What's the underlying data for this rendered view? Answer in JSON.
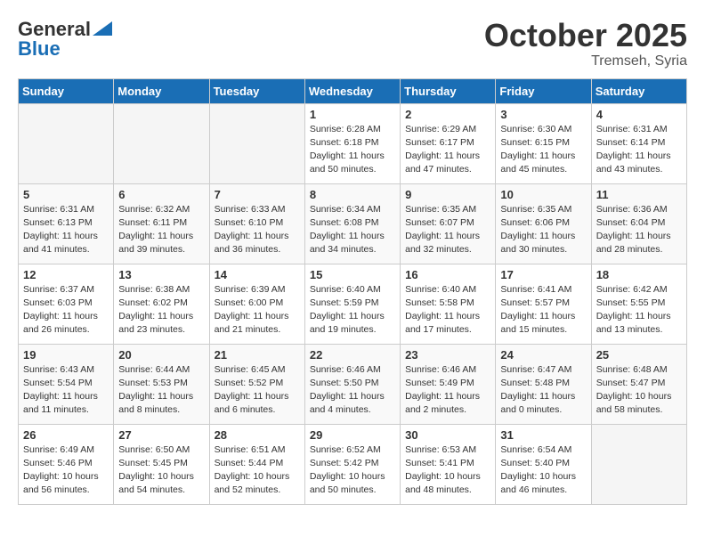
{
  "header": {
    "logo_general": "General",
    "logo_blue": "Blue",
    "month_title": "October 2025",
    "location": "Tremseh, Syria"
  },
  "weekdays": [
    "Sunday",
    "Monday",
    "Tuesday",
    "Wednesday",
    "Thursday",
    "Friday",
    "Saturday"
  ],
  "weeks": [
    [
      {
        "day": "",
        "empty": true
      },
      {
        "day": "",
        "empty": true
      },
      {
        "day": "",
        "empty": true
      },
      {
        "day": "1",
        "sunrise": "Sunrise: 6:28 AM",
        "sunset": "Sunset: 6:18 PM",
        "daylight": "Daylight: 11 hours and 50 minutes."
      },
      {
        "day": "2",
        "sunrise": "Sunrise: 6:29 AM",
        "sunset": "Sunset: 6:17 PM",
        "daylight": "Daylight: 11 hours and 47 minutes."
      },
      {
        "day": "3",
        "sunrise": "Sunrise: 6:30 AM",
        "sunset": "Sunset: 6:15 PM",
        "daylight": "Daylight: 11 hours and 45 minutes."
      },
      {
        "day": "4",
        "sunrise": "Sunrise: 6:31 AM",
        "sunset": "Sunset: 6:14 PM",
        "daylight": "Daylight: 11 hours and 43 minutes."
      }
    ],
    [
      {
        "day": "5",
        "sunrise": "Sunrise: 6:31 AM",
        "sunset": "Sunset: 6:13 PM",
        "daylight": "Daylight: 11 hours and 41 minutes."
      },
      {
        "day": "6",
        "sunrise": "Sunrise: 6:32 AM",
        "sunset": "Sunset: 6:11 PM",
        "daylight": "Daylight: 11 hours and 39 minutes."
      },
      {
        "day": "7",
        "sunrise": "Sunrise: 6:33 AM",
        "sunset": "Sunset: 6:10 PM",
        "daylight": "Daylight: 11 hours and 36 minutes."
      },
      {
        "day": "8",
        "sunrise": "Sunrise: 6:34 AM",
        "sunset": "Sunset: 6:08 PM",
        "daylight": "Daylight: 11 hours and 34 minutes."
      },
      {
        "day": "9",
        "sunrise": "Sunrise: 6:35 AM",
        "sunset": "Sunset: 6:07 PM",
        "daylight": "Daylight: 11 hours and 32 minutes."
      },
      {
        "day": "10",
        "sunrise": "Sunrise: 6:35 AM",
        "sunset": "Sunset: 6:06 PM",
        "daylight": "Daylight: 11 hours and 30 minutes."
      },
      {
        "day": "11",
        "sunrise": "Sunrise: 6:36 AM",
        "sunset": "Sunset: 6:04 PM",
        "daylight": "Daylight: 11 hours and 28 minutes."
      }
    ],
    [
      {
        "day": "12",
        "sunrise": "Sunrise: 6:37 AM",
        "sunset": "Sunset: 6:03 PM",
        "daylight": "Daylight: 11 hours and 26 minutes."
      },
      {
        "day": "13",
        "sunrise": "Sunrise: 6:38 AM",
        "sunset": "Sunset: 6:02 PM",
        "daylight": "Daylight: 11 hours and 23 minutes."
      },
      {
        "day": "14",
        "sunrise": "Sunrise: 6:39 AM",
        "sunset": "Sunset: 6:00 PM",
        "daylight": "Daylight: 11 hours and 21 minutes."
      },
      {
        "day": "15",
        "sunrise": "Sunrise: 6:40 AM",
        "sunset": "Sunset: 5:59 PM",
        "daylight": "Daylight: 11 hours and 19 minutes."
      },
      {
        "day": "16",
        "sunrise": "Sunrise: 6:40 AM",
        "sunset": "Sunset: 5:58 PM",
        "daylight": "Daylight: 11 hours and 17 minutes."
      },
      {
        "day": "17",
        "sunrise": "Sunrise: 6:41 AM",
        "sunset": "Sunset: 5:57 PM",
        "daylight": "Daylight: 11 hours and 15 minutes."
      },
      {
        "day": "18",
        "sunrise": "Sunrise: 6:42 AM",
        "sunset": "Sunset: 5:55 PM",
        "daylight": "Daylight: 11 hours and 13 minutes."
      }
    ],
    [
      {
        "day": "19",
        "sunrise": "Sunrise: 6:43 AM",
        "sunset": "Sunset: 5:54 PM",
        "daylight": "Daylight: 11 hours and 11 minutes."
      },
      {
        "day": "20",
        "sunrise": "Sunrise: 6:44 AM",
        "sunset": "Sunset: 5:53 PM",
        "daylight": "Daylight: 11 hours and 8 minutes."
      },
      {
        "day": "21",
        "sunrise": "Sunrise: 6:45 AM",
        "sunset": "Sunset: 5:52 PM",
        "daylight": "Daylight: 11 hours and 6 minutes."
      },
      {
        "day": "22",
        "sunrise": "Sunrise: 6:46 AM",
        "sunset": "Sunset: 5:50 PM",
        "daylight": "Daylight: 11 hours and 4 minutes."
      },
      {
        "day": "23",
        "sunrise": "Sunrise: 6:46 AM",
        "sunset": "Sunset: 5:49 PM",
        "daylight": "Daylight: 11 hours and 2 minutes."
      },
      {
        "day": "24",
        "sunrise": "Sunrise: 6:47 AM",
        "sunset": "Sunset: 5:48 PM",
        "daylight": "Daylight: 11 hours and 0 minutes."
      },
      {
        "day": "25",
        "sunrise": "Sunrise: 6:48 AM",
        "sunset": "Sunset: 5:47 PM",
        "daylight": "Daylight: 10 hours and 58 minutes."
      }
    ],
    [
      {
        "day": "26",
        "sunrise": "Sunrise: 6:49 AM",
        "sunset": "Sunset: 5:46 PM",
        "daylight": "Daylight: 10 hours and 56 minutes."
      },
      {
        "day": "27",
        "sunrise": "Sunrise: 6:50 AM",
        "sunset": "Sunset: 5:45 PM",
        "daylight": "Daylight: 10 hours and 54 minutes."
      },
      {
        "day": "28",
        "sunrise": "Sunrise: 6:51 AM",
        "sunset": "Sunset: 5:44 PM",
        "daylight": "Daylight: 10 hours and 52 minutes."
      },
      {
        "day": "29",
        "sunrise": "Sunrise: 6:52 AM",
        "sunset": "Sunset: 5:42 PM",
        "daylight": "Daylight: 10 hours and 50 minutes."
      },
      {
        "day": "30",
        "sunrise": "Sunrise: 6:53 AM",
        "sunset": "Sunset: 5:41 PM",
        "daylight": "Daylight: 10 hours and 48 minutes."
      },
      {
        "day": "31",
        "sunrise": "Sunrise: 6:54 AM",
        "sunset": "Sunset: 5:40 PM",
        "daylight": "Daylight: 10 hours and 46 minutes."
      },
      {
        "day": "",
        "empty": true
      }
    ]
  ]
}
